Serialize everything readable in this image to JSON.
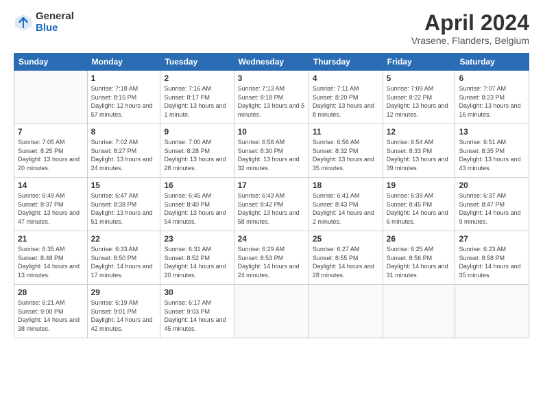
{
  "logo": {
    "general": "General",
    "blue": "Blue"
  },
  "header": {
    "month_year": "April 2024",
    "location": "Vrasene, Flanders, Belgium"
  },
  "weekdays": [
    "Sunday",
    "Monday",
    "Tuesday",
    "Wednesday",
    "Thursday",
    "Friday",
    "Saturday"
  ],
  "weeks": [
    [
      {
        "day": "",
        "sunrise": "",
        "sunset": "",
        "daylight": ""
      },
      {
        "day": "1",
        "sunrise": "Sunrise: 7:18 AM",
        "sunset": "Sunset: 8:15 PM",
        "daylight": "Daylight: 12 hours and 57 minutes."
      },
      {
        "day": "2",
        "sunrise": "Sunrise: 7:16 AM",
        "sunset": "Sunset: 8:17 PM",
        "daylight": "Daylight: 13 hours and 1 minute."
      },
      {
        "day": "3",
        "sunrise": "Sunrise: 7:13 AM",
        "sunset": "Sunset: 8:18 PM",
        "daylight": "Daylight: 13 hours and 5 minutes."
      },
      {
        "day": "4",
        "sunrise": "Sunrise: 7:11 AM",
        "sunset": "Sunset: 8:20 PM",
        "daylight": "Daylight: 13 hours and 8 minutes."
      },
      {
        "day": "5",
        "sunrise": "Sunrise: 7:09 AM",
        "sunset": "Sunset: 8:22 PM",
        "daylight": "Daylight: 13 hours and 12 minutes."
      },
      {
        "day": "6",
        "sunrise": "Sunrise: 7:07 AM",
        "sunset": "Sunset: 8:23 PM",
        "daylight": "Daylight: 13 hours and 16 minutes."
      }
    ],
    [
      {
        "day": "7",
        "sunrise": "Sunrise: 7:05 AM",
        "sunset": "Sunset: 8:25 PM",
        "daylight": "Daylight: 13 hours and 20 minutes."
      },
      {
        "day": "8",
        "sunrise": "Sunrise: 7:02 AM",
        "sunset": "Sunset: 8:27 PM",
        "daylight": "Daylight: 13 hours and 24 minutes."
      },
      {
        "day": "9",
        "sunrise": "Sunrise: 7:00 AM",
        "sunset": "Sunset: 8:28 PM",
        "daylight": "Daylight: 13 hours and 28 minutes."
      },
      {
        "day": "10",
        "sunrise": "Sunrise: 6:58 AM",
        "sunset": "Sunset: 8:30 PM",
        "daylight": "Daylight: 13 hours and 32 minutes."
      },
      {
        "day": "11",
        "sunrise": "Sunrise: 6:56 AM",
        "sunset": "Sunset: 8:32 PM",
        "daylight": "Daylight: 13 hours and 35 minutes."
      },
      {
        "day": "12",
        "sunrise": "Sunrise: 6:54 AM",
        "sunset": "Sunset: 8:33 PM",
        "daylight": "Daylight: 13 hours and 39 minutes."
      },
      {
        "day": "13",
        "sunrise": "Sunrise: 6:51 AM",
        "sunset": "Sunset: 8:35 PM",
        "daylight": "Daylight: 13 hours and 43 minutes."
      }
    ],
    [
      {
        "day": "14",
        "sunrise": "Sunrise: 6:49 AM",
        "sunset": "Sunset: 8:37 PM",
        "daylight": "Daylight: 13 hours and 47 minutes."
      },
      {
        "day": "15",
        "sunrise": "Sunrise: 6:47 AM",
        "sunset": "Sunset: 8:38 PM",
        "daylight": "Daylight: 13 hours and 51 minutes."
      },
      {
        "day": "16",
        "sunrise": "Sunrise: 6:45 AM",
        "sunset": "Sunset: 8:40 PM",
        "daylight": "Daylight: 13 hours and 54 minutes."
      },
      {
        "day": "17",
        "sunrise": "Sunrise: 6:43 AM",
        "sunset": "Sunset: 8:42 PM",
        "daylight": "Daylight: 13 hours and 58 minutes."
      },
      {
        "day": "18",
        "sunrise": "Sunrise: 6:41 AM",
        "sunset": "Sunset: 8:43 PM",
        "daylight": "Daylight: 14 hours and 2 minutes."
      },
      {
        "day": "19",
        "sunrise": "Sunrise: 6:39 AM",
        "sunset": "Sunset: 8:45 PM",
        "daylight": "Daylight: 14 hours and 6 minutes."
      },
      {
        "day": "20",
        "sunrise": "Sunrise: 6:37 AM",
        "sunset": "Sunset: 8:47 PM",
        "daylight": "Daylight: 14 hours and 9 minutes."
      }
    ],
    [
      {
        "day": "21",
        "sunrise": "Sunrise: 6:35 AM",
        "sunset": "Sunset: 8:48 PM",
        "daylight": "Daylight: 14 hours and 13 minutes."
      },
      {
        "day": "22",
        "sunrise": "Sunrise: 6:33 AM",
        "sunset": "Sunset: 8:50 PM",
        "daylight": "Daylight: 14 hours and 17 minutes."
      },
      {
        "day": "23",
        "sunrise": "Sunrise: 6:31 AM",
        "sunset": "Sunset: 8:52 PM",
        "daylight": "Daylight: 14 hours and 20 minutes."
      },
      {
        "day": "24",
        "sunrise": "Sunrise: 6:29 AM",
        "sunset": "Sunset: 8:53 PM",
        "daylight": "Daylight: 14 hours and 24 minutes."
      },
      {
        "day": "25",
        "sunrise": "Sunrise: 6:27 AM",
        "sunset": "Sunset: 8:55 PM",
        "daylight": "Daylight: 14 hours and 28 minutes."
      },
      {
        "day": "26",
        "sunrise": "Sunrise: 6:25 AM",
        "sunset": "Sunset: 8:56 PM",
        "daylight": "Daylight: 14 hours and 31 minutes."
      },
      {
        "day": "27",
        "sunrise": "Sunrise: 6:23 AM",
        "sunset": "Sunset: 8:58 PM",
        "daylight": "Daylight: 14 hours and 35 minutes."
      }
    ],
    [
      {
        "day": "28",
        "sunrise": "Sunrise: 6:21 AM",
        "sunset": "Sunset: 9:00 PM",
        "daylight": "Daylight: 14 hours and 38 minutes."
      },
      {
        "day": "29",
        "sunrise": "Sunrise: 6:19 AM",
        "sunset": "Sunset: 9:01 PM",
        "daylight": "Daylight: 14 hours and 42 minutes."
      },
      {
        "day": "30",
        "sunrise": "Sunrise: 6:17 AM",
        "sunset": "Sunset: 9:03 PM",
        "daylight": "Daylight: 14 hours and 45 minutes."
      },
      {
        "day": "",
        "sunrise": "",
        "sunset": "",
        "daylight": ""
      },
      {
        "day": "",
        "sunrise": "",
        "sunset": "",
        "daylight": ""
      },
      {
        "day": "",
        "sunrise": "",
        "sunset": "",
        "daylight": ""
      },
      {
        "day": "",
        "sunrise": "",
        "sunset": "",
        "daylight": ""
      }
    ]
  ]
}
